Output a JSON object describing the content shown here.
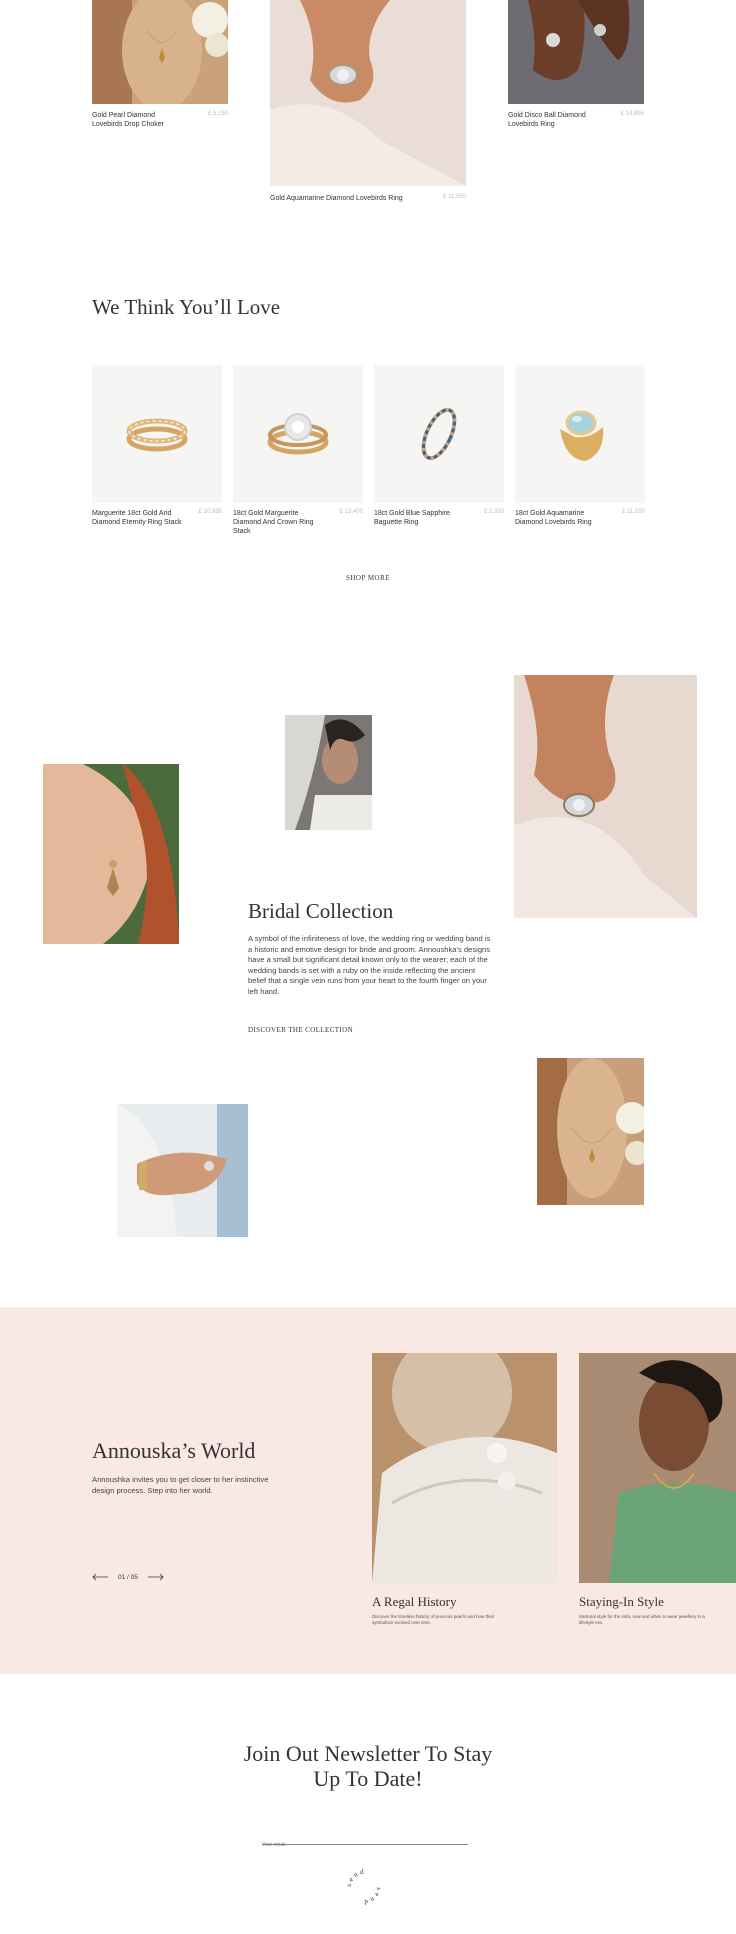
{
  "top_products": [
    {
      "name": "Gold Pearl Diamond Lovebirds Drop Choker",
      "price": "£ 5,150"
    },
    {
      "name": "Gold Aquamarine Diamond Lovebirds Ring",
      "price": "£ 11,550"
    },
    {
      "name": "Gold Disco Ball Diamond Lovebirds Ring",
      "price": "£ 14,995"
    }
  ],
  "recommend": {
    "title": "We Think You’ll Love",
    "items": [
      {
        "name": "Marguerite 18ct Gold And Diamond Eternity Ring Stack",
        "price": "£ 10,895"
      },
      {
        "name": "18ct Gold Marguerite Diamond And Crown Ring Stack",
        "price": "£ 13,400"
      },
      {
        "name": "18ct Gold Blue Sapphire Baguette Ring",
        "price": "£ 2,350"
      },
      {
        "name": "18ct Gold Aquamarine Diamond Lovebirds Ring",
        "price": "£ 11,550"
      }
    ],
    "cta": "SHOP MORE"
  },
  "bridal": {
    "title": "Bridal Collection",
    "body": "A symbol of the infiniteness of love, the wedding ring or wedding band is a historic and emotive design for bride and groom. Annoushka's designs have a small but significant detail known only to the wearer; each of the wedding bands is set with a ruby on the inside reflecting the ancient belief that a single vein runs from your heart to the fourth finger on your left hand.",
    "cta": "DISCOVER THE COLLECTION"
  },
  "world": {
    "title": "Annouska’s World",
    "text": "Annoushka invites you to get closer to her instinctive design process. Step into her world.",
    "pager": "01 / 05",
    "stories": [
      {
        "title": "A Regal History",
        "text": "Discover the timeless history of precious pearls and how their symbolism evolved over time."
      },
      {
        "title": "Staying-In Style",
        "text": "Sartorial style for the sofa, now and when to wear jewellery in a lifestyle era."
      }
    ]
  },
  "newsletter": {
    "title_line1": "Join Out Newsletter To Stay",
    "title_line2": "Up To Date!",
    "placeholder": "Your email",
    "send": "send",
    "send2": "send"
  },
  "colors": {
    "world_bg": "#f9e8e3",
    "product_bg": "#f5f5f4"
  }
}
